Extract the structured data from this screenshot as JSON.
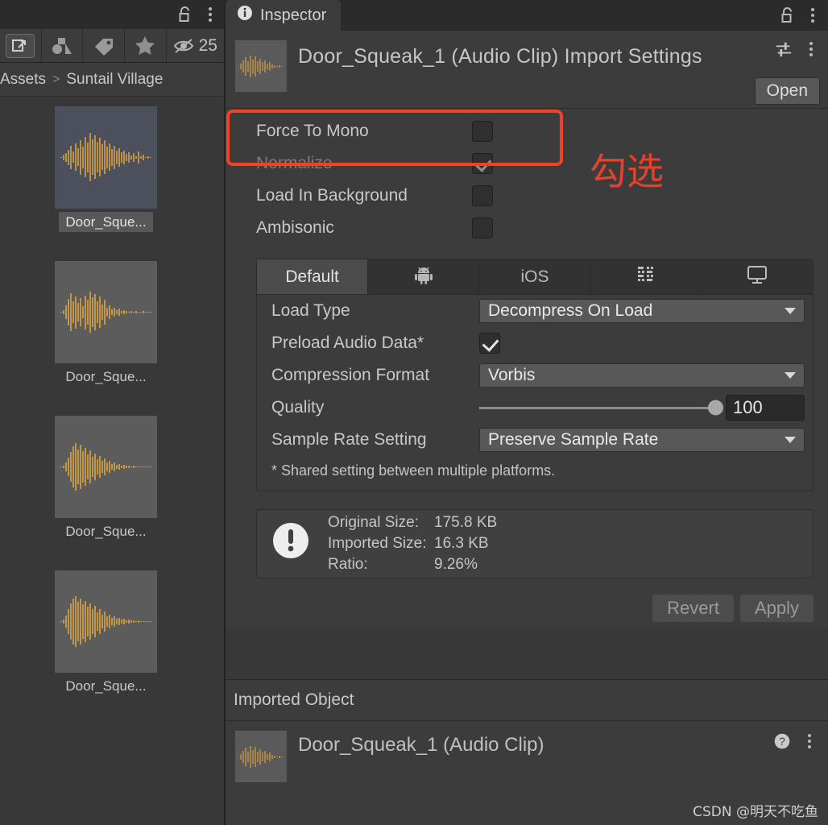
{
  "project_panel": {
    "topbar": {
      "lock_icon": "unlock-icon",
      "menu_icon": "kebab-menu-icon"
    },
    "toolbar": {
      "items": [
        {
          "name": "open-in-new-window-icon",
          "label": ""
        },
        {
          "name": "shapes-filter-icon",
          "label": ""
        },
        {
          "name": "tag-filter-icon",
          "label": ""
        },
        {
          "name": "favorite-star-icon",
          "label": ""
        }
      ],
      "hidden_icon": "eye-off-icon",
      "hidden_count": "25"
    },
    "breadcrumb": {
      "root": "Assets",
      "separator": ">",
      "current": "Suntail Village"
    },
    "assets": [
      {
        "label": "Door_Sque...",
        "selected": true
      },
      {
        "label": "Door_Sque...",
        "selected": false
      },
      {
        "label": "Door_Sque...",
        "selected": false
      },
      {
        "label": "Door_Sque...",
        "selected": false
      }
    ]
  },
  "inspector": {
    "tab": {
      "label": "Inspector",
      "icon": "info-icon"
    },
    "tabbar_icons": {
      "lock": "unlock-icon",
      "menu": "kebab-menu-icon"
    },
    "header": {
      "title": "Door_Squeak_1 (Audio Clip) Import Settings",
      "thumbnail": "audio-waveform-icon",
      "preset_icon": "preset-sliders-icon",
      "menu_icon": "kebab-menu-icon",
      "open_label": "Open"
    },
    "properties": [
      {
        "label": "Force To Mono",
        "checked": false,
        "disabled": false,
        "highlighted": true
      },
      {
        "label": "Normalize",
        "checked": true,
        "disabled": true,
        "highlighted": false
      },
      {
        "label": "Load In Background",
        "checked": false,
        "disabled": false,
        "highlighted": false
      },
      {
        "label": "Ambisonic",
        "checked": false,
        "disabled": false,
        "highlighted": false
      }
    ],
    "annotation": {
      "text": "勾选",
      "color": "#e8402a"
    },
    "highlight_color": "#f04326",
    "platform_tabs": [
      {
        "label": "Default",
        "icon": "",
        "active": true
      },
      {
        "label": "",
        "icon": "android-icon",
        "active": false
      },
      {
        "label": "iOS",
        "icon": "",
        "active": false
      },
      {
        "label": "",
        "icon": "webgl-blocks-icon",
        "active": false
      },
      {
        "label": "",
        "icon": "standalone-monitor-icon",
        "active": false
      }
    ],
    "settings": {
      "load_type": {
        "label": "Load Type",
        "value": "Decompress On Load"
      },
      "preload_audio_data": {
        "label": "Preload Audio Data*",
        "checked": true
      },
      "compression_format": {
        "label": "Compression Format",
        "value": "Vorbis"
      },
      "quality": {
        "label": "Quality",
        "value": "100",
        "percent": 100
      },
      "sample_rate_setting": {
        "label": "Sample Rate Setting",
        "value": "Preserve Sample Rate"
      },
      "shared_note": "* Shared setting between multiple platforms."
    },
    "info_box": {
      "icon": "warning-info-icon",
      "rows": [
        {
          "key": "Original Size:",
          "value": "175.8 KB"
        },
        {
          "key": "Imported Size:",
          "value": "16.3 KB"
        },
        {
          "key": "Ratio:",
          "value": "9.26%"
        }
      ]
    },
    "buttons": {
      "revert": "Revert",
      "apply": "Apply"
    },
    "imported_object": {
      "section_title": "Imported Object",
      "name": "Door_Squeak_1 (Audio Clip)",
      "thumbnail": "audio-waveform-icon",
      "help_icon": "help-circle-icon",
      "menu_icon": "kebab-menu-icon"
    }
  },
  "watermark": {
    "text": "CSDN @明天不吃鱼"
  }
}
